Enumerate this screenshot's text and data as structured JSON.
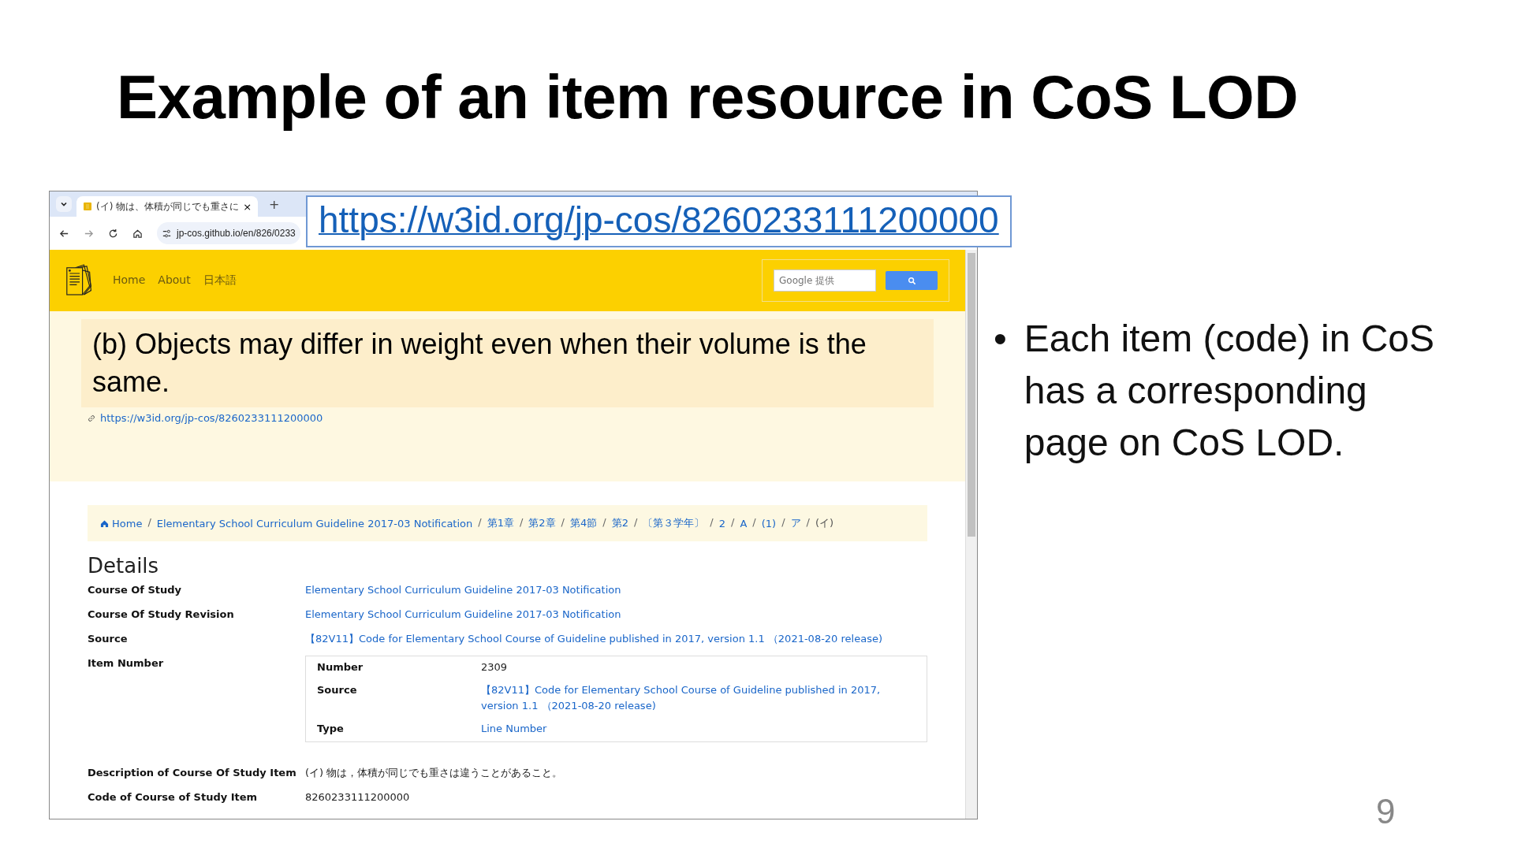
{
  "slide": {
    "title": "Example of an item resource in CoS LOD",
    "bullet_marker": "•",
    "bullets": [
      "Each item (code) in CoS has a corresponding page on CoS LOD."
    ],
    "page_number": "9"
  },
  "callout": {
    "url": "https://w3id.org/jp-cos/8260233111200000"
  },
  "browser": {
    "tab": {
      "title": "(イ) 物は、体積が同じでも重さに",
      "close": "×",
      "selected": true
    },
    "new_tab": "+",
    "address": "jp-cos.github.io/en/826/0233"
  },
  "site": {
    "nav": [
      "Home",
      "About",
      "日本語"
    ],
    "search": {
      "placeholder": "Google 提供"
    },
    "hero": {
      "text": "(b) Objects may differ in weight even when their volume is the same.",
      "link": "https://w3id.org/jp-cos/8260233111200000"
    },
    "breadcrumb": {
      "separator": "/",
      "items": [
        {
          "label": "Home",
          "kind": "home"
        },
        {
          "label": "Elementary School Curriculum Guideline 2017-03 Notification",
          "kind": "link"
        },
        {
          "label": "第1章",
          "kind": "link"
        },
        {
          "label": "第2章",
          "kind": "link"
        },
        {
          "label": "第4節",
          "kind": "link"
        },
        {
          "label": "第2",
          "kind": "link"
        },
        {
          "label": "〔第３学年〕",
          "kind": "link"
        },
        {
          "label": "2",
          "kind": "link"
        },
        {
          "label": "A",
          "kind": "link"
        },
        {
          "label": "(1)",
          "kind": "link"
        },
        {
          "label": "ア",
          "kind": "link"
        },
        {
          "label": "(イ)",
          "kind": "current"
        }
      ]
    },
    "details": {
      "heading": "Details",
      "rows": [
        {
          "label": "Course Of Study",
          "kind": "link",
          "value": "Elementary School Curriculum Guideline 2017-03 Notification"
        },
        {
          "label": "Course Of Study Revision",
          "kind": "link",
          "value": "Elementary School Curriculum Guideline 2017-03 Notification"
        },
        {
          "label": "Source",
          "kind": "link",
          "value": "【82V11】Code for Elementary School Course of Guideline published in 2017, version 1.1 （2021-08-20 release)"
        },
        {
          "label": "Item Number",
          "kind": "table",
          "rows": [
            {
              "label": "Number",
              "kind": "text",
              "value": "2309"
            },
            {
              "label": "Source",
              "kind": "link",
              "value": "【82V11】Code for Elementary School Course of Guideline published in 2017, version 1.1 （2021-08-20 release)"
            },
            {
              "label": "Type",
              "kind": "link",
              "value": "Line Number"
            }
          ]
        },
        {
          "label": "Description of Course Of Study Item",
          "kind": "text",
          "value": "(イ) 物は，体積が同じでも重さは違うことがあること。"
        },
        {
          "label": "Code of Course of Study Item",
          "kind": "text",
          "value": "8260233111200000"
        }
      ]
    }
  }
}
